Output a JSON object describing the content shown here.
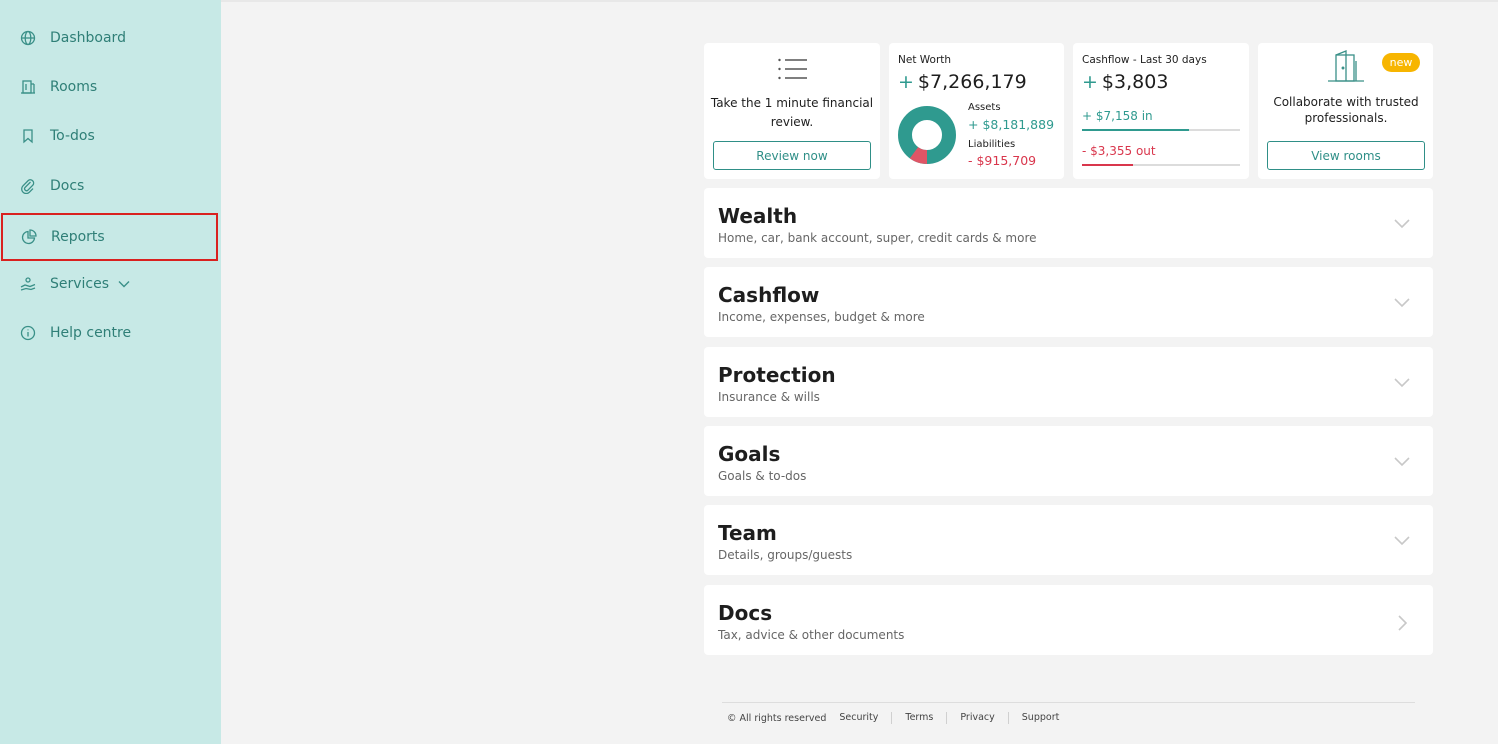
{
  "sidebar": {
    "items": [
      {
        "label": "Dashboard",
        "icon": "globe-icon"
      },
      {
        "label": "Rooms",
        "icon": "building-icon"
      },
      {
        "label": "To-dos",
        "icon": "bookmark-icon"
      },
      {
        "label": "Docs",
        "icon": "paperclip-icon"
      },
      {
        "label": "Reports",
        "icon": "pie-chart-icon"
      },
      {
        "label": "Services",
        "icon": "hand-icon"
      },
      {
        "label": "Help centre",
        "icon": "info-icon"
      }
    ]
  },
  "cards": {
    "review": {
      "text": "Take the 1 minute financial review.",
      "button": "Review now"
    },
    "net_worth": {
      "label": "Net Worth",
      "sign": "+",
      "value": "$7,266,179",
      "assets_label": "Assets",
      "assets_value": "+ $8,181,889",
      "liabilities_label": "Liabilities",
      "liabilities_value": "- $915,709",
      "assets_fraction": 0.899
    },
    "cashflow": {
      "label": "Cashflow - Last 30 days",
      "sign": "+",
      "value": "$3,803",
      "in_value": "+ $7,158",
      "in_word": "in",
      "out_value": "- $3,355",
      "out_word": "out",
      "in_fraction": 0.68,
      "out_fraction": 0.32
    },
    "rooms": {
      "badge": "new",
      "text": "Collaborate with trusted professionals.",
      "button": "View rooms"
    }
  },
  "sections": [
    {
      "title": "Wealth",
      "subtitle": "Home, car, bank account, super, credit cards & more"
    },
    {
      "title": "Cashflow",
      "subtitle": "Income, expenses, budget & more"
    },
    {
      "title": "Protection",
      "subtitle": "Insurance & wills"
    },
    {
      "title": "Goals",
      "subtitle": "Goals & to-dos"
    },
    {
      "title": "Team",
      "subtitle": "Details, groups/guests"
    },
    {
      "title": "Docs",
      "subtitle": "Tax, advice & other documents"
    }
  ],
  "footer": {
    "copyright": "© All rights reserved",
    "links": [
      "Security",
      "Terms",
      "Privacy",
      "Support"
    ]
  },
  "colors": {
    "teal": "#2f9a8f",
    "red": "#d9364c",
    "sidebar_bg": "#c7e9e6",
    "badge": "#f7b500"
  }
}
